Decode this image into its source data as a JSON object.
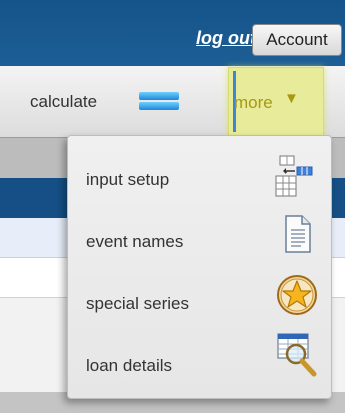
{
  "header": {
    "logout_label": "log out",
    "account_label": "Account"
  },
  "toolbar": {
    "calculate_label": "calculate",
    "calculate_icon": "calculate-equals-icon",
    "more_label": "more",
    "more_icon": "dropdown-arrow-icon"
  },
  "dropdown": {
    "items": [
      {
        "label": "input setup",
        "icon": "input-setup-icon"
      },
      {
        "label": "event names",
        "icon": "document-icon"
      },
      {
        "label": "special series",
        "icon": "star-icon"
      },
      {
        "label": "loan details",
        "icon": "magnifier-icon"
      }
    ]
  },
  "colors": {
    "header_blue": "#15548a",
    "highlight_yellow": "#e8ec9a",
    "more_text": "#a59a12"
  }
}
